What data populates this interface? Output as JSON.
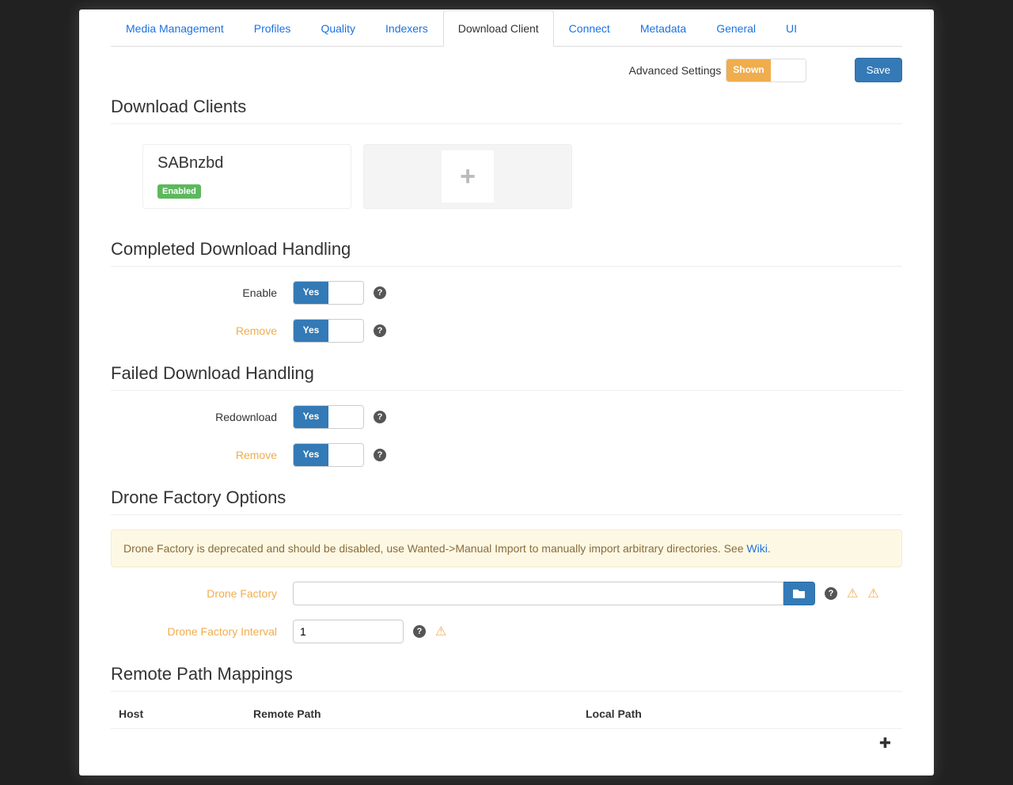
{
  "tabs": [
    "Media Management",
    "Profiles",
    "Quality",
    "Indexers",
    "Download Client",
    "Connect",
    "Metadata",
    "General",
    "UI"
  ],
  "active_tab": "Download Client",
  "header": {
    "advanced_label": "Advanced Settings",
    "advanced_toggle": "Shown",
    "save": "Save"
  },
  "sections": {
    "clients": "Download Clients",
    "completed": "Completed Download Handling",
    "failed": "Failed Download Handling",
    "drone": "Drone Factory Options",
    "remote": "Remote Path Mappings"
  },
  "client": {
    "name": "SABnzbd",
    "status": "Enabled"
  },
  "completed": {
    "enable_label": "Enable",
    "remove_label": "Remove",
    "yes": "Yes"
  },
  "failed": {
    "redownload_label": "Redownload",
    "remove_label": "Remove",
    "yes": "Yes"
  },
  "drone": {
    "alert_text": "Drone Factory is deprecated and should be disabled, use Wanted->Manual Import to manually import arbitrary directories. See ",
    "alert_link": "Wiki",
    "path_label": "Drone Factory",
    "interval_label": "Drone Factory Interval",
    "interval_value": "1"
  },
  "remote": {
    "host": "Host",
    "remote_path": "Remote Path",
    "local_path": "Local Path"
  }
}
